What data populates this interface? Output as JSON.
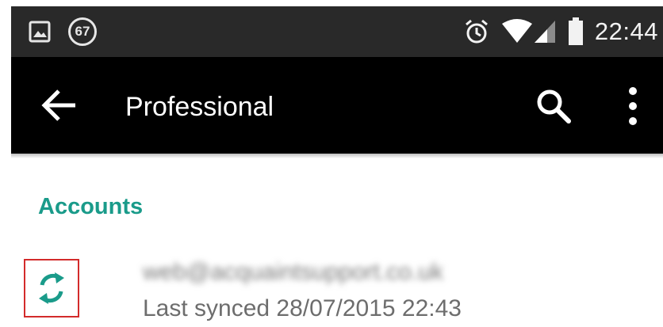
{
  "status_bar": {
    "notification_badge": "67",
    "time": "22:44",
    "icons": [
      "image-icon",
      "alarm-icon",
      "wifi-icon",
      "signal-icon",
      "battery-icon"
    ]
  },
  "toolbar": {
    "title": "Professional",
    "icons": [
      "back-arrow-icon",
      "search-icon",
      "more-vert-icon"
    ]
  },
  "content": {
    "section_header": "Accounts",
    "account": {
      "email": "web@acquaintsupport.co.uk",
      "last_synced": "Last synced 28/07/2015 22:43",
      "sync_icon": "sync-icon"
    }
  },
  "colors": {
    "status_bar": "#292929",
    "toolbar": "#000000",
    "accent": "#1a9b8a",
    "highlight_border": "#d32b2b"
  }
}
